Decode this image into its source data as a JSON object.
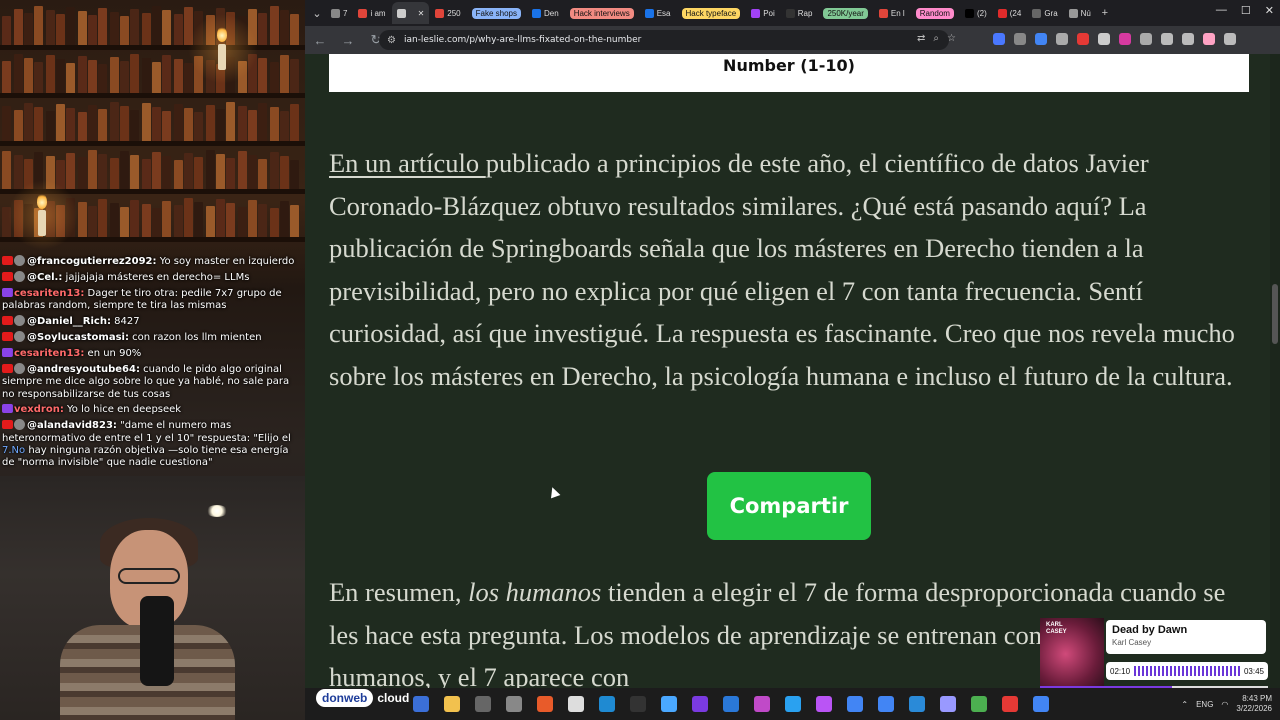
{
  "browser": {
    "tabs": [
      {
        "label": "7",
        "fav_color": "#888888"
      },
      {
        "label": "i am",
        "fav_color": "#e0453a"
      },
      {
        "label": "",
        "fav_color": "#cccccc",
        "active": true
      },
      {
        "label": "250",
        "fav_color": "#e0453a"
      },
      {
        "label": "Fake shops",
        "group_color": "#8ab4f8"
      },
      {
        "label": "Den",
        "fav_color": "#1a73e8"
      },
      {
        "label": "Hack interviews",
        "group_color": "#f28b82"
      },
      {
        "label": "Esa",
        "fav_color": "#1a73e8"
      },
      {
        "label": "Hack typeface",
        "group_color": "#fdd663"
      },
      {
        "label": "Poi",
        "fav_color": "#a142f4"
      },
      {
        "label": "Rap",
        "fav_color": "#333333"
      },
      {
        "label": "250K/year",
        "group_color": "#81c995"
      },
      {
        "label": "En l",
        "fav_color": "#e0453a"
      },
      {
        "label": "Random",
        "group_color": "#ff8bcb"
      },
      {
        "label": "(2)",
        "fav_color": "#000000"
      },
      {
        "label": "(24",
        "fav_color": "#e02b2b"
      },
      {
        "label": "Gra",
        "fav_color": "#666666"
      },
      {
        "label": "Nú",
        "fav_color": "#999999"
      }
    ],
    "new_tab_label": "+",
    "url": "ian-leslie.com/p/why-are-llms-fixated-on-the-number",
    "extension_colors": [
      "#4a78ff",
      "#888",
      "#4285f4",
      "#aaa",
      "#e53935",
      "#ccc",
      "#d63aa0",
      "#aaa",
      "#bbb",
      "#bbb",
      "#ffa3c4",
      "#bbb"
    ]
  },
  "page": {
    "table_caption": "Number (1-10)",
    "para1_link": "En un artículo ",
    "para1_text": "publicado a principios de este año, el científico de datos Javier Coronado-Blázquez obtuvo resultados similares. ¿Qué está pasando aquí? La publicación de Springboards señala que los másteres en Derecho tienden a la previsibilidad, pero no explica por qué eligen el 7 con tanta frecuencia. Sentí curiosidad, así que investigué. La respuesta es fascinante. Creo que nos revela mucho sobre los másteres en Derecho, la psicología humana e incluso el futuro de la cultura.",
    "share_label": "Compartir",
    "para2_start": "En resumen, ",
    "para2_em": "los humanos",
    "para2_rest": " tienden a elegir el 7 de forma desproporcionada cuando se les hace esta pregunta. Los modelos de aprendizaje se entrenan con texto generado por humanos, y el 7 aparece con"
  },
  "chat": [
    {
      "platform": "yt",
      "user": "@francogutierrez2092:",
      "text": " Yo soy master en izquierdo"
    },
    {
      "platform": "yt",
      "user": "@Cel.:",
      "text": " jajjajaja másteres en derecho= LLMs"
    },
    {
      "platform": "tw",
      "user": "cesariten13:",
      "text": " Dager te tiro otra: pedile 7x7 grupo de palabras random, siempre te tira las mismas"
    },
    {
      "platform": "yt",
      "user": "@Daniel__Rich:",
      "text": " 8427"
    },
    {
      "platform": "yt",
      "user": "@Soylucastomasi:",
      "text": " con razon los llm mienten"
    },
    {
      "platform": "tw",
      "user": "cesariten13:",
      "text": " en un 90%"
    },
    {
      "platform": "yt",
      "user": "@andresyoutube64:",
      "text": " cuando le pido algo original siempre me dice algo sobre lo que ya hablé, no sale para no responsabilizarse de tus cosas"
    },
    {
      "platform": "tw",
      "user": "vexdron:",
      "text": " Yo lo hice en deepseek"
    },
    {
      "platform": "yt",
      "user": "@alandavid823:",
      "text": " \"dame el numero mas heteronormativo de entre el 1 y el 10\" respuesta: \"Elijo el ",
      "highlight": "7.No",
      "text_after": " hay ninguna razón objetiva —solo tiene esa energía de \"norma invisible\" que nadie cuestiona\""
    }
  ],
  "sponsor": {
    "brand": "donweb",
    "suffix": "cloud"
  },
  "music": {
    "title": "Dead by Dawn",
    "artist": "Karl Casey",
    "album_text": "KARL CASEY",
    "elapsed": "02:10",
    "duration": "03:45",
    "progress": 0.58
  },
  "taskbar": {
    "icon_colors": [
      "#3b6fd8",
      "#f2c14e",
      "#666",
      "#888",
      "#e85b2a",
      "#ddd",
      "#1f8ad2",
      "#333",
      "#4aa8ff",
      "#7a3ae0",
      "#2a78d8",
      "#c04ac8",
      "#2aa1f0",
      "#ba54f5",
      "#4285f4",
      "#4285f4",
      "#2a8ad8",
      "#9999ff",
      "#4caf50",
      "#e53935",
      "#4285f4"
    ],
    "language": "ENG",
    "time": "8:43 PM",
    "date": "3/22/2026"
  }
}
